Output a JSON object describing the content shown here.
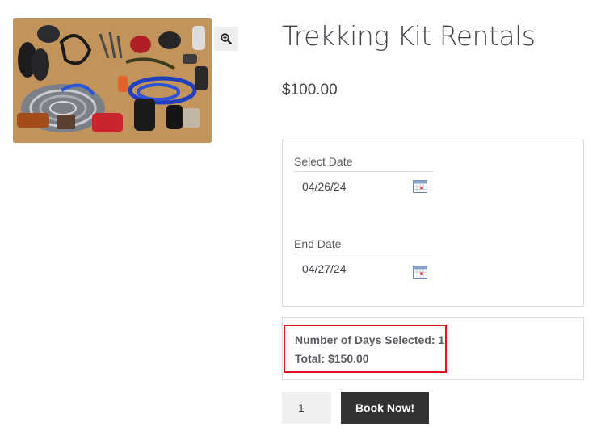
{
  "product": {
    "title": "Trekking Kit Rentals",
    "price": "$100.00",
    "image_alt": "Trekking gear laid out: helmet, ropes, shoes, bags, carabiners"
  },
  "booking": {
    "start": {
      "label": "Select Date",
      "value": "04/26/24"
    },
    "end": {
      "label": "End Date",
      "value": "04/27/24"
    }
  },
  "summary": {
    "days_line": "Number of Days Selected: 1",
    "total_line": "Total: $150.00",
    "highlight_color": "#e8141c"
  },
  "cart": {
    "quantity": "1",
    "book_label": "Book Now!"
  },
  "icons": {
    "zoom": "zoom-in-icon",
    "calendar": "calendar-icon"
  }
}
